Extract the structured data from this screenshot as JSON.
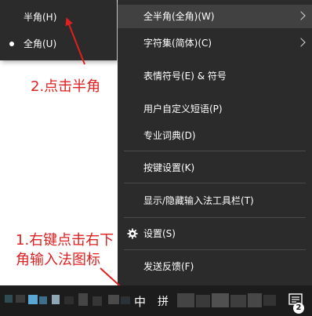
{
  "submenu": {
    "items": [
      {
        "label": "半角(H)",
        "selected": false
      },
      {
        "label": "全角(U)",
        "selected": true
      }
    ]
  },
  "context_menu": {
    "items": [
      {
        "label": "全半角(全角)(W)",
        "has_submenu": true,
        "highlighted": true
      },
      {
        "label": "字符集(简体)(C)",
        "has_submenu": true
      },
      {
        "label": "表情符号(E) & 符号"
      },
      {
        "label": "用户自定义短语(P)"
      },
      {
        "label": "专业词典(D)"
      },
      {
        "label": "按键设置(K)"
      },
      {
        "label": "显示/隐藏输入法工具栏(T)"
      },
      {
        "label": "设置(S)",
        "icon": "gear-icon"
      },
      {
        "label": "发送反馈(F)"
      }
    ]
  },
  "annotations": {
    "step2": "2.点击半角",
    "step1_line1": "1.右键点击右下",
    "step1_line2": "角输入法图标"
  },
  "taskbar": {
    "ime_mode": "中",
    "ime_icon": "拼",
    "notification_count": "2"
  },
  "colors": {
    "menu_bg": "#2b2b2b",
    "menu_highlight": "#414141",
    "annotation": "#e02020",
    "taskbar_bg": "#1c1c1c"
  }
}
